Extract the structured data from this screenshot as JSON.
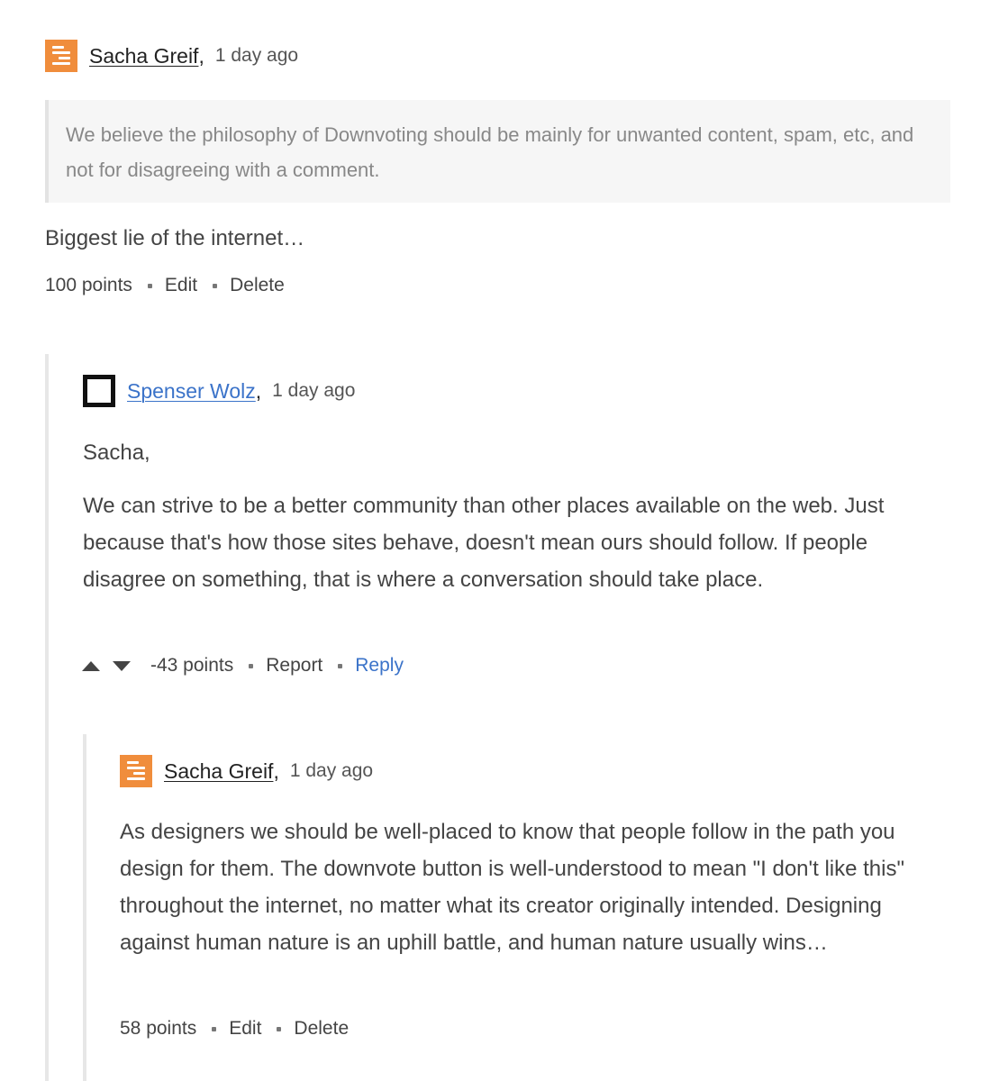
{
  "comment_1": {
    "author": "Sacha Greif",
    "time": "1 day ago",
    "quote": "We believe the philosophy of Downvoting should be mainly for unwanted content, spam, etc, and not for disagreeing with a comment.",
    "body": "Biggest lie of the internet…",
    "points": "100 points",
    "edit_label": "Edit",
    "delete_label": "Delete"
  },
  "comment_2": {
    "author": "Spenser Wolz",
    "time": "1 day ago",
    "greeting": "Sacha,",
    "body": "We can strive to be a better community than other places available on the web. Just because that's how those sites behave, doesn't mean ours should follow. If people disagree on something, that is where a conversation should take place.",
    "points": "-43 points",
    "report_label": "Report",
    "reply_label": "Reply"
  },
  "comment_3": {
    "author": "Sacha Greif",
    "time": "1 day ago",
    "body": "As designers we should be well-placed to know that people follow in the path you design for them. The downvote button is well-understood to mean \"I don't like this\" throughout the internet, no matter what its creator originally intended. Designing against human nature is an uphill battle, and human nature usually wins…",
    "points": "58 points",
    "edit_label": "Edit",
    "delete_label": "Delete"
  },
  "colors": {
    "avatar_orange": "#f08d3c",
    "link_blue": "#3b73c9",
    "thread_line": "#e7e7e7"
  }
}
